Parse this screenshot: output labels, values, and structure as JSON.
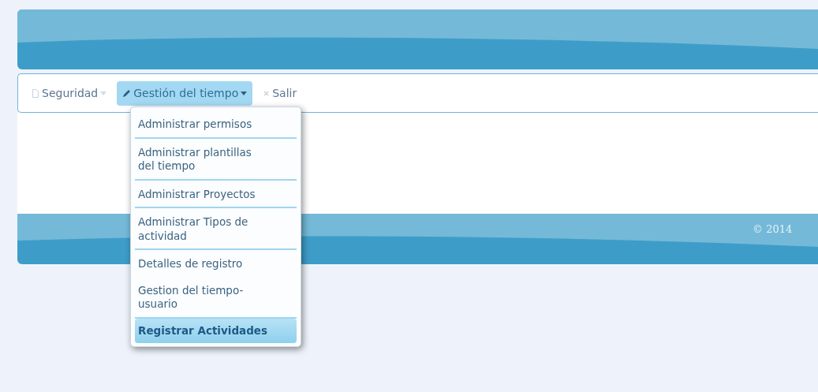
{
  "nav": [
    {
      "label": "Seguridad",
      "kind": "dropdown",
      "selected": false
    },
    {
      "label": "Gestión del tiempo",
      "kind": "dropdown",
      "selected": true
    },
    {
      "label": "Salir",
      "kind": "link",
      "selected": false
    }
  ],
  "menu": [
    {
      "label": "Administrar permisos",
      "separated": true,
      "selected": false
    },
    {
      "label": "Administrar plantillas del tiempo",
      "separated": true,
      "selected": false
    },
    {
      "label": "Administrar Proyectos",
      "separated": true,
      "selected": false
    },
    {
      "label": "Administrar Tipos de actividad",
      "separated": true,
      "selected": false
    },
    {
      "label": "Detalles de registro",
      "separated": false,
      "selected": false
    },
    {
      "label": "Gestion del tiempo-usuario",
      "separated": true,
      "selected": false
    },
    {
      "label": "Registrar Actividades",
      "separated": false,
      "selected": true
    }
  ],
  "footer": {
    "copyright": "© 2014"
  }
}
